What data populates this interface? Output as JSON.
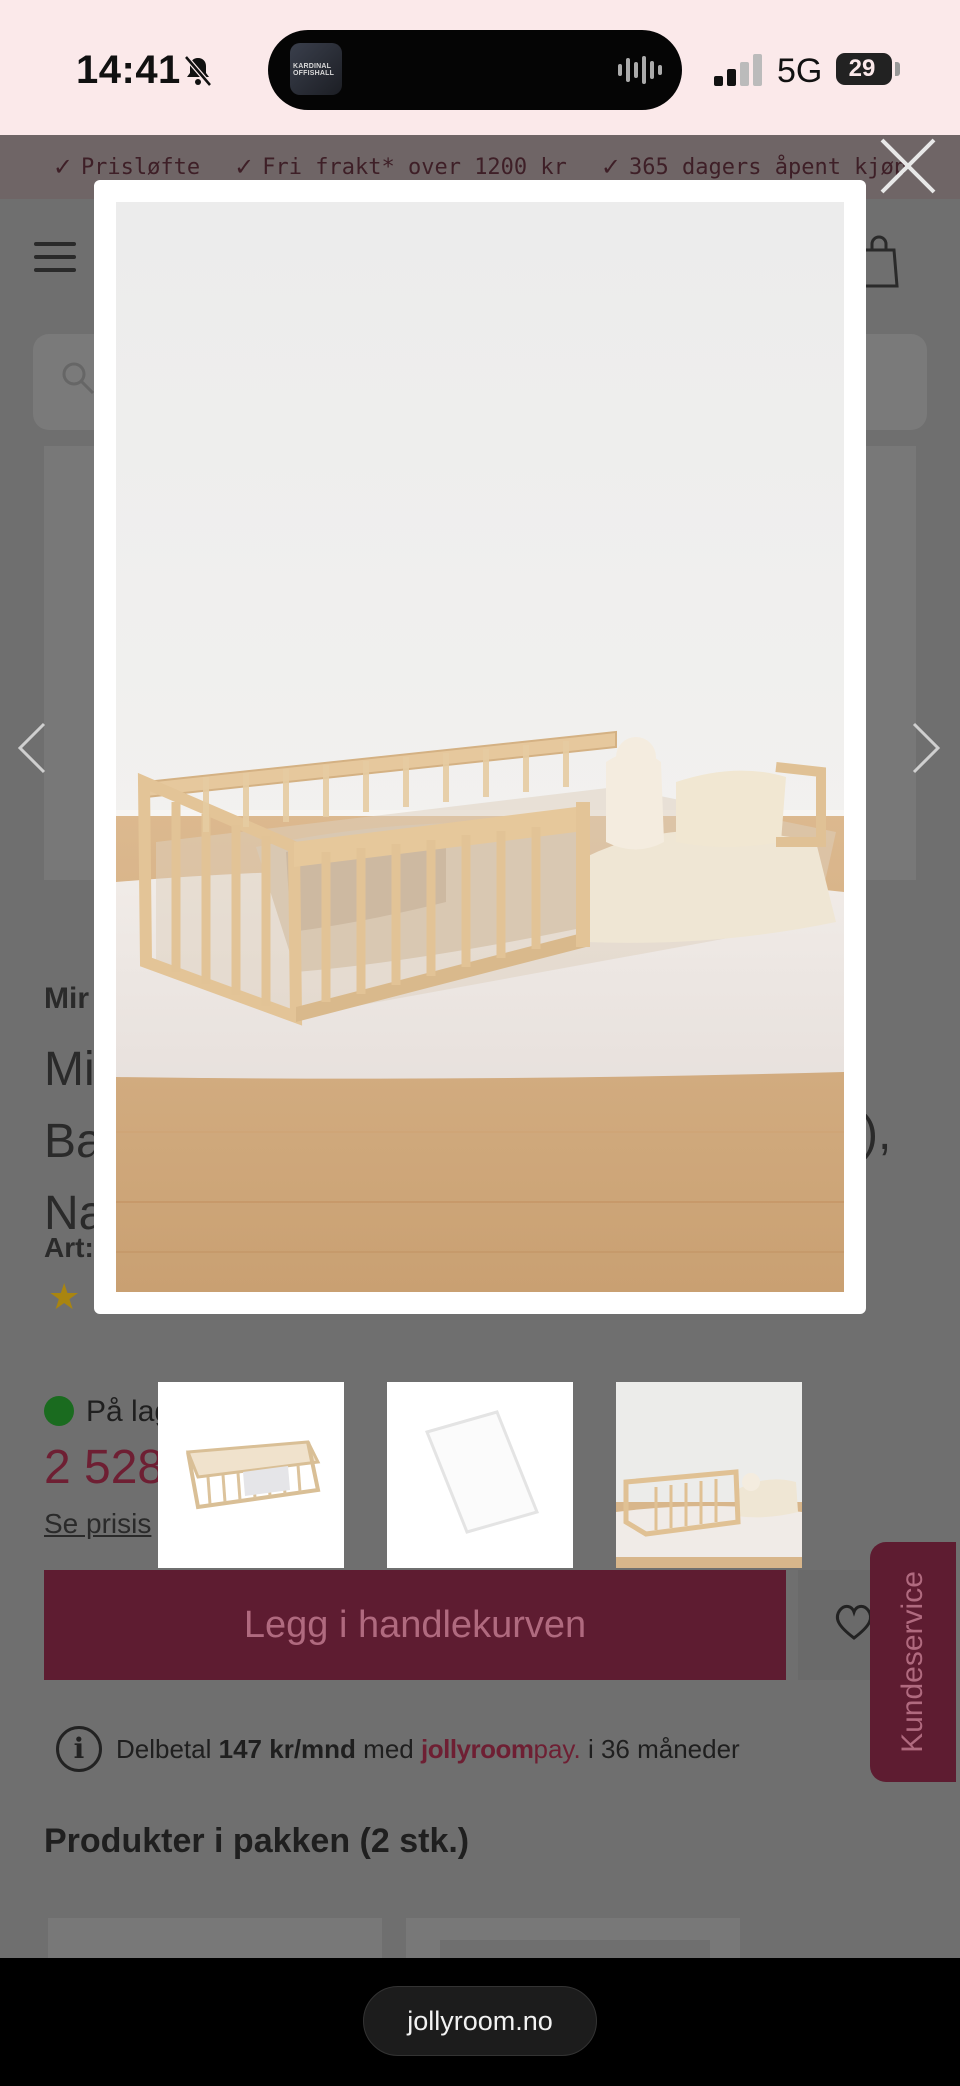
{
  "status_bar": {
    "time": "14:41",
    "network": "5G",
    "battery": "29",
    "island_art_text": "KARDINAL OFFISHALL"
  },
  "promo_bar": {
    "items": [
      {
        "label": "Prisløfte"
      },
      {
        "label": "Fri frakt* over 1200 kr"
      },
      {
        "label": "365 dagers åpent kjøp"
      }
    ]
  },
  "icons": {
    "check": "✓",
    "info": "i",
    "star": "★"
  },
  "product": {
    "brand_fragment": "Mir",
    "title_fragments": [
      "Mi",
      "Ba",
      "Na"
    ],
    "title_comma": "),",
    "article_fragment": "Art:",
    "stock_fragment": "På lag",
    "price_fragment": "2 528",
    "price_history_fragment": "Se prisis",
    "cart_button": "Legg i handlekurven",
    "customer_service": "Kundeservice",
    "payment": {
      "prefix": "Delbetal",
      "amount": "147 kr/mnd",
      "middle": "med",
      "brand": "jollyroom",
      "brand_suffix": "pay.",
      "suffix": "i 36 måneder"
    },
    "package_heading": "Produkter i pakken (2 stk.)"
  },
  "gallery": {
    "active_image": "wooden-floor-bed-with-bunny-pillow-and-blanket",
    "thumbnails": [
      "floor-bed-frame",
      "white-mattress",
      "floor-bed-with-bedding"
    ]
  },
  "browser": {
    "url": "jollyroom.no"
  },
  "colors": {
    "brand": "#6e1f33",
    "overlay": "#6f6f6f",
    "status_bar_bg": "#fbe9ea"
  }
}
